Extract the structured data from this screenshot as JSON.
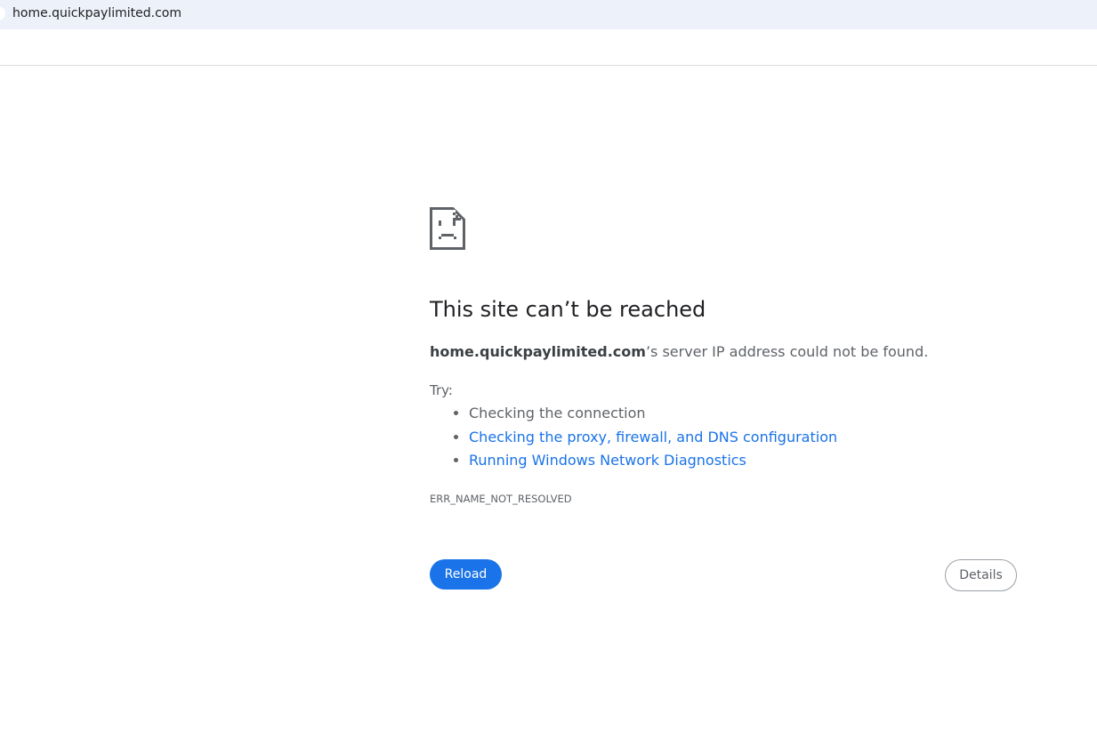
{
  "address_bar": {
    "url": "home.quickpaylimited.com"
  },
  "error": {
    "title": "This site can’t be reached",
    "host": "home.quickpaylimited.com",
    "summary_rest": "’s server IP address could not be found.",
    "try_label": "Try:",
    "suggestions": [
      {
        "text": "Checking the connection"
      },
      {
        "text": "Checking the proxy, firewall, and DNS configuration"
      },
      {
        "text": "Running Windows Network Diagnostics"
      }
    ],
    "code": "ERR_NAME_NOT_RESOLVED"
  },
  "buttons": {
    "reload": "Reload",
    "details": "Details"
  }
}
